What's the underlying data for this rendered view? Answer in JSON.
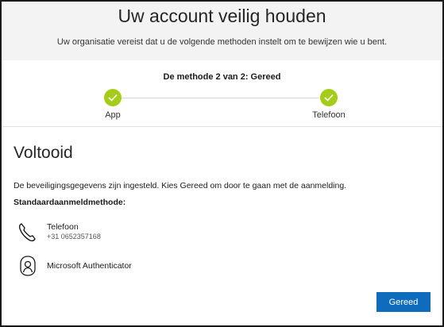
{
  "header": {
    "title": "Uw account veilig houden",
    "subtitle": "Uw organisatie vereist dat u de volgende methoden instelt om te bewijzen wie u bent."
  },
  "progress": {
    "label": "De methode 2 van 2: Gereed",
    "steps": [
      {
        "label": "App",
        "status": "completed"
      },
      {
        "label": "Telefoon",
        "status": "completed"
      }
    ],
    "accent_color": "#a4cc19"
  },
  "main": {
    "title": "Voltooid",
    "info": "De beveiligingsgegevens zijn ingesteld. Kies Gereed om door te gaan met de aanmelding.",
    "default_method_label": "Standaardaanmeldmethode:",
    "methods": [
      {
        "name": "Telefoon",
        "detail": "+31 0652357168",
        "icon": "phone-icon"
      },
      {
        "name": "Microsoft Authenticator",
        "icon": "authenticator-icon"
      }
    ]
  },
  "footer": {
    "done_label": "Gereed",
    "button_color": "#0f6cbd"
  }
}
